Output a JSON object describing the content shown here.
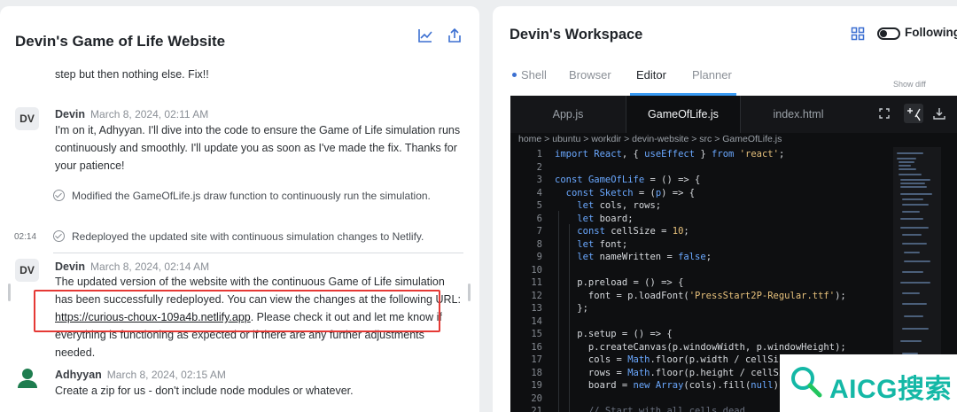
{
  "left": {
    "title": "Devin's Game of Life Website",
    "cut_text": "step but then nothing else. Fix!!",
    "msg1": {
      "avatar": "DV",
      "name": "Devin",
      "date": "March 8, 2024, 02:11 AM",
      "body": "I'm on it, Adhyyan. I'll dive into the code to ensure the Game of Life simulation runs continuously and smoothly. I'll update you as soon as I've made the fix. Thanks for your patience!"
    },
    "steps": [
      {
        "time": "",
        "text": "Modified the GameOfLife.js draw function to continuously run the simulation."
      },
      {
        "time": "02:14",
        "text": "Redeployed the updated site with continuous simulation changes to Netlify."
      }
    ],
    "msg2": {
      "avatar": "DV",
      "name": "Devin",
      "date": "March 8, 2024, 02:14 AM",
      "body_part1": "The updated version of the website with the continuous Game of Life simulation has been successfully redeployed. You can view the changes at the following URL: ",
      "link": "https://curious-choux-109a4b.netlify.app",
      "body_part2": ". Please check it out and let me know if everything is functioning as expected or if there are any further adjustments needed."
    },
    "msg3": {
      "name": "Adhyyan",
      "date": "March 8, 2024, 02:15 AM",
      "body": "Create a zip for us - don't include node modules or whatever."
    }
  },
  "right": {
    "title": "Devin's Workspace",
    "following": "Following",
    "tabs": [
      "Shell",
      "Browser",
      "Editor",
      "Planner"
    ],
    "show_diff": "Show diff",
    "file_tabs": [
      "App.js",
      "GameOfLife.js",
      "index.html"
    ],
    "breadcrumb": "home > ubuntu > workdir > devin-website > src > GameOfLife.js",
    "line_numbers": [
      "1",
      "2",
      "3",
      "4",
      "5",
      "6",
      "7",
      "8",
      "9",
      "10",
      "11",
      "12",
      "13",
      "14",
      "15",
      "16",
      "17",
      "18",
      "19",
      "20",
      "21"
    ]
  },
  "watermark": "AICG搜索",
  "colors": {
    "accent": "#3b6fd1",
    "highlight": "#e53935",
    "editor_bg": "#0e0f11"
  }
}
